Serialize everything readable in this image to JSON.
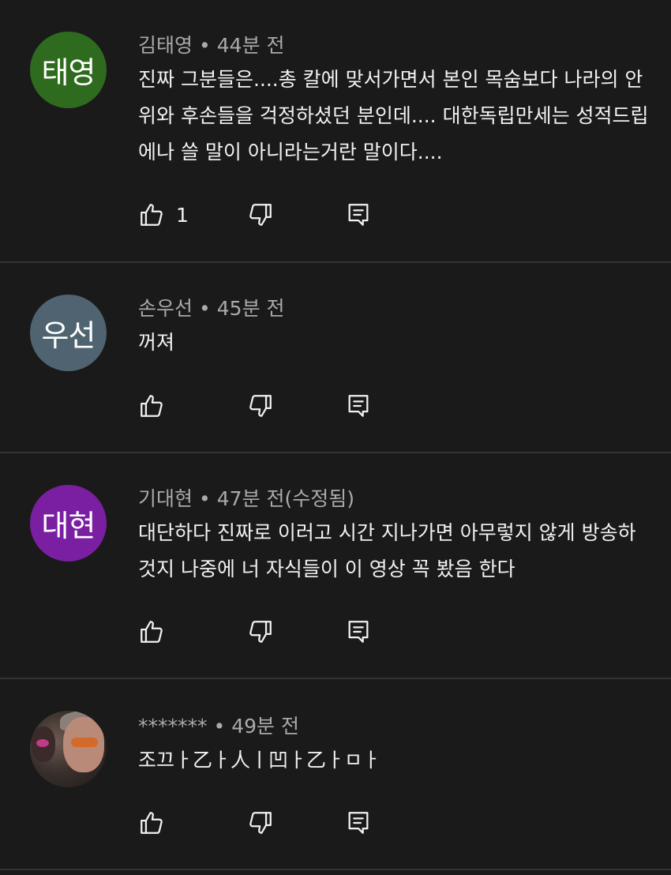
{
  "comments": [
    {
      "author": "김태영",
      "time": "44분 전",
      "avatar_text": "태영",
      "avatar_color": "#2f6b1f",
      "text": "진짜 그분들은....총 칼에 맞서가면서 본인 목숨보다 나라의 안\n위와 후손들을 걱정하셨던 분인데.... 대한독립만세는 성적드립\n에나 쓸 말이 아니라는거란 말이다....",
      "likes": "1"
    },
    {
      "author": "손우선",
      "time": "45분 전",
      "avatar_text": "우선",
      "avatar_color": "#4f6470",
      "text": "꺼져",
      "likes": ""
    },
    {
      "author": "기대현",
      "time": "47분 전(수정됨)",
      "avatar_text": "대현",
      "avatar_color": "#7b1fa2",
      "text": "대단하다 진짜로 이러고 시간 지나가면 아무렇지 않게 방송하\n것지 나중에 너 자식들이 이 영상 꼭 봤음 한다",
      "likes": ""
    },
    {
      "author": "*******",
      "time": "49분 전",
      "avatar_text": "",
      "avatar_color": "#3a302c",
      "text": "조끄ㅏ乙ㅏ人ㅣ凹ㅏ乙ㅏㅁㅏ",
      "likes": ""
    }
  ],
  "icons": {
    "like": "thumbs-up-icon",
    "dislike": "thumbs-down-icon",
    "reply": "reply-icon"
  }
}
